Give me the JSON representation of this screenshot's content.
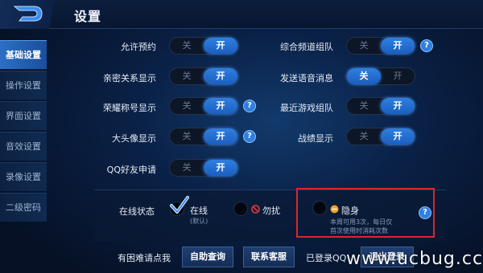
{
  "header": {
    "title": "设置"
  },
  "sidebar": {
    "items": [
      {
        "label": "基础设置"
      },
      {
        "label": "操作设置"
      },
      {
        "label": "界面设置"
      },
      {
        "label": "音效设置"
      },
      {
        "label": "录像设置"
      },
      {
        "label": "二级密码"
      }
    ]
  },
  "settings": {
    "toggle_off_label": "关",
    "toggle_on_label": "开",
    "help_glyph": "?",
    "rows": [
      {
        "label": "允许预约",
        "value": "开"
      },
      {
        "label": "亲密关系显示",
        "value": "开"
      },
      {
        "label": "荣耀称号显示",
        "value": "开"
      },
      {
        "label": "大头像显示",
        "value": "开"
      },
      {
        "label": "QQ好友申请",
        "value": "开"
      },
      {
        "label": "综合频道组队",
        "value": "开"
      },
      {
        "label": "发送语音消息",
        "value": "关"
      },
      {
        "label": "最近游戏组队",
        "value": "开"
      },
      {
        "label": "战绩显示",
        "value": "开"
      }
    ]
  },
  "online_status": {
    "label": "在线状态",
    "selected": "在线",
    "options": [
      {
        "label": "在线",
        "sub": "(默认)"
      },
      {
        "label": "勿扰",
        "sub": ""
      },
      {
        "label": "隐身",
        "sub_line1": "本周可用3次，每日仅",
        "sub_line2": "首次使用时消耗次数"
      }
    ]
  },
  "footer": {
    "help_text": "有困难请点我",
    "self_help_button": "自助查询",
    "contact_button": "联系客服",
    "logged_in_text": "已登录QQ",
    "logout_button": "退出登录"
  },
  "watermark": "www.ucbug.cc",
  "colors": {
    "accent": "#2f7fe0",
    "highlight_box": "#d9262e"
  }
}
